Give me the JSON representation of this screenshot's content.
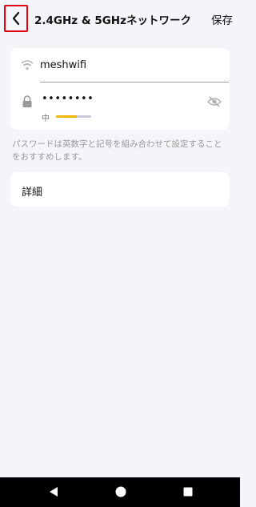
{
  "header": {
    "title": "2.4GHz & 5GHzネットワーク",
    "save_label": "保存"
  },
  "network": {
    "ssid": "meshwifi",
    "password_masked": "••••••••",
    "strength_label": "中",
    "strength_level": 0.6
  },
  "hint": "パスワードは英数字と記号を組み合わせて設定することをおすすめします。",
  "details_label": "詳細",
  "icons": {
    "back": "chevron-left-icon",
    "wifi": "wifi-icon",
    "lock": "lock-icon",
    "visibility": "eye-off-icon",
    "nav_back": "triangle-back-icon",
    "nav_home": "circle-home-icon",
    "nav_recents": "square-recents-icon"
  },
  "colors": {
    "highlight": "#e0000f",
    "strength_fill": "#f2b600",
    "strength_track": "#c8c8d8"
  }
}
